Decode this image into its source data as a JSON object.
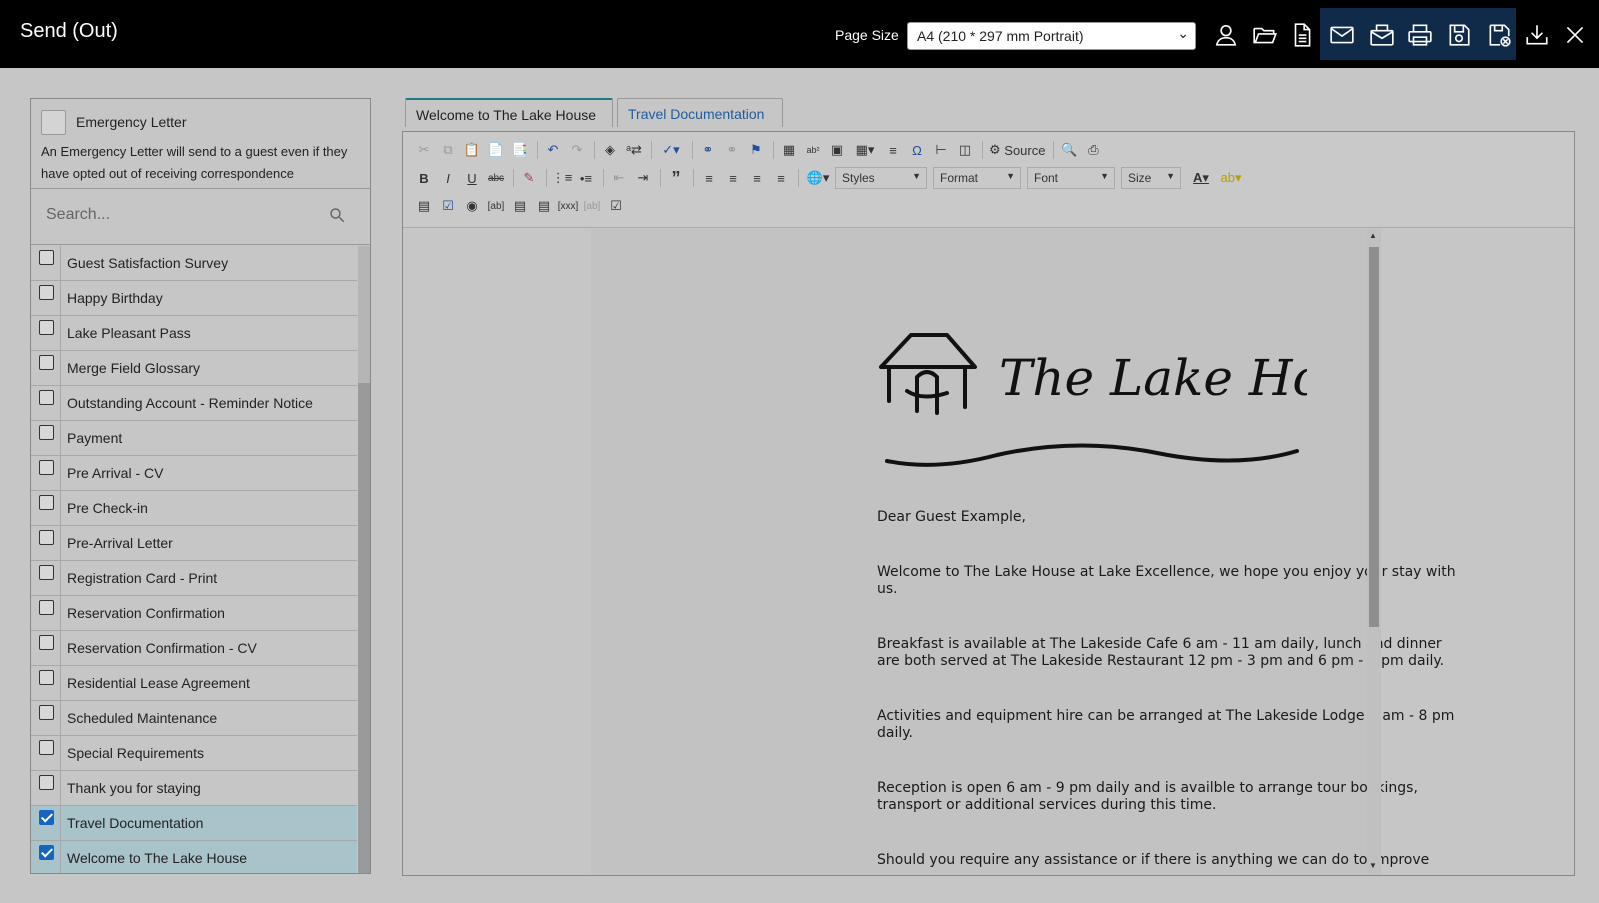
{
  "header": {
    "title": "Send (Out)",
    "page_size_label": "Page Size",
    "page_size_value": "A4 (210 * 297 mm Portrait)"
  },
  "toolbar_icons": [
    "user-icon",
    "folder-open-icon",
    "document-icon",
    "email-icon",
    "email-attachment-icon",
    "print-icon",
    "save-icon",
    "save-close-icon",
    "download-icon",
    "close-icon"
  ],
  "emergency": {
    "label": "Emergency Letter",
    "description": "An Emergency Letter will send to a guest even if they have opted out of receiving correspondence"
  },
  "search": {
    "placeholder": "Search..."
  },
  "letters": [
    {
      "label": "Guest Satisfaction Survey",
      "checked": false
    },
    {
      "label": "Happy Birthday",
      "checked": false
    },
    {
      "label": "Lake Pleasant Pass",
      "checked": false
    },
    {
      "label": "Merge Field Glossary",
      "checked": false
    },
    {
      "label": "Outstanding Account - Reminder Notice",
      "checked": false
    },
    {
      "label": "Payment",
      "checked": false
    },
    {
      "label": "Pre Arrival - CV",
      "checked": false
    },
    {
      "label": "Pre Check-in",
      "checked": false
    },
    {
      "label": "Pre-Arrival Letter",
      "checked": false
    },
    {
      "label": "Registration Card - Print",
      "checked": false
    },
    {
      "label": "Reservation Confirmation",
      "checked": false
    },
    {
      "label": "Reservation Confirmation - CV",
      "checked": false
    },
    {
      "label": "Residential Lease Agreement",
      "checked": false
    },
    {
      "label": "Scheduled Maintenance",
      "checked": false
    },
    {
      "label": "Special Requirements",
      "checked": false
    },
    {
      "label": "Thank you for staying",
      "checked": false
    },
    {
      "label": "Travel Documentation",
      "checked": true
    },
    {
      "label": "Welcome to The Lake House",
      "checked": true
    }
  ],
  "tabs": [
    {
      "label": "Welcome to The Lake House",
      "active": true
    },
    {
      "label": "Travel Documentation",
      "active": false
    }
  ],
  "editor": {
    "source_label": "Source",
    "combos": {
      "styles": "Styles",
      "format": "Format",
      "font": "Font",
      "size": "Size"
    }
  },
  "document": {
    "logo_text": "The Lake House.",
    "paragraphs": [
      "Dear Guest Example,",
      "Welcome to The Lake House at Lake Excellence, we hope you enjoy your stay with us.",
      "Breakfast is available at The Lakeside Cafe 6 am - 11 am daily, lunch and dinner are both served at The Lakeside Restaurant 12 pm - 3 pm and 6 pm - 9 pm daily.",
      "Activities and equipment hire can be arranged at The Lakeside Lodge 6 am - 8 pm daily.",
      "Reception is open 6 am - 9 pm daily and is availble to arrange tour bookings, transport or additional services during this time.",
      "Should you require any assistance or if there is anything we can do to improve"
    ]
  }
}
